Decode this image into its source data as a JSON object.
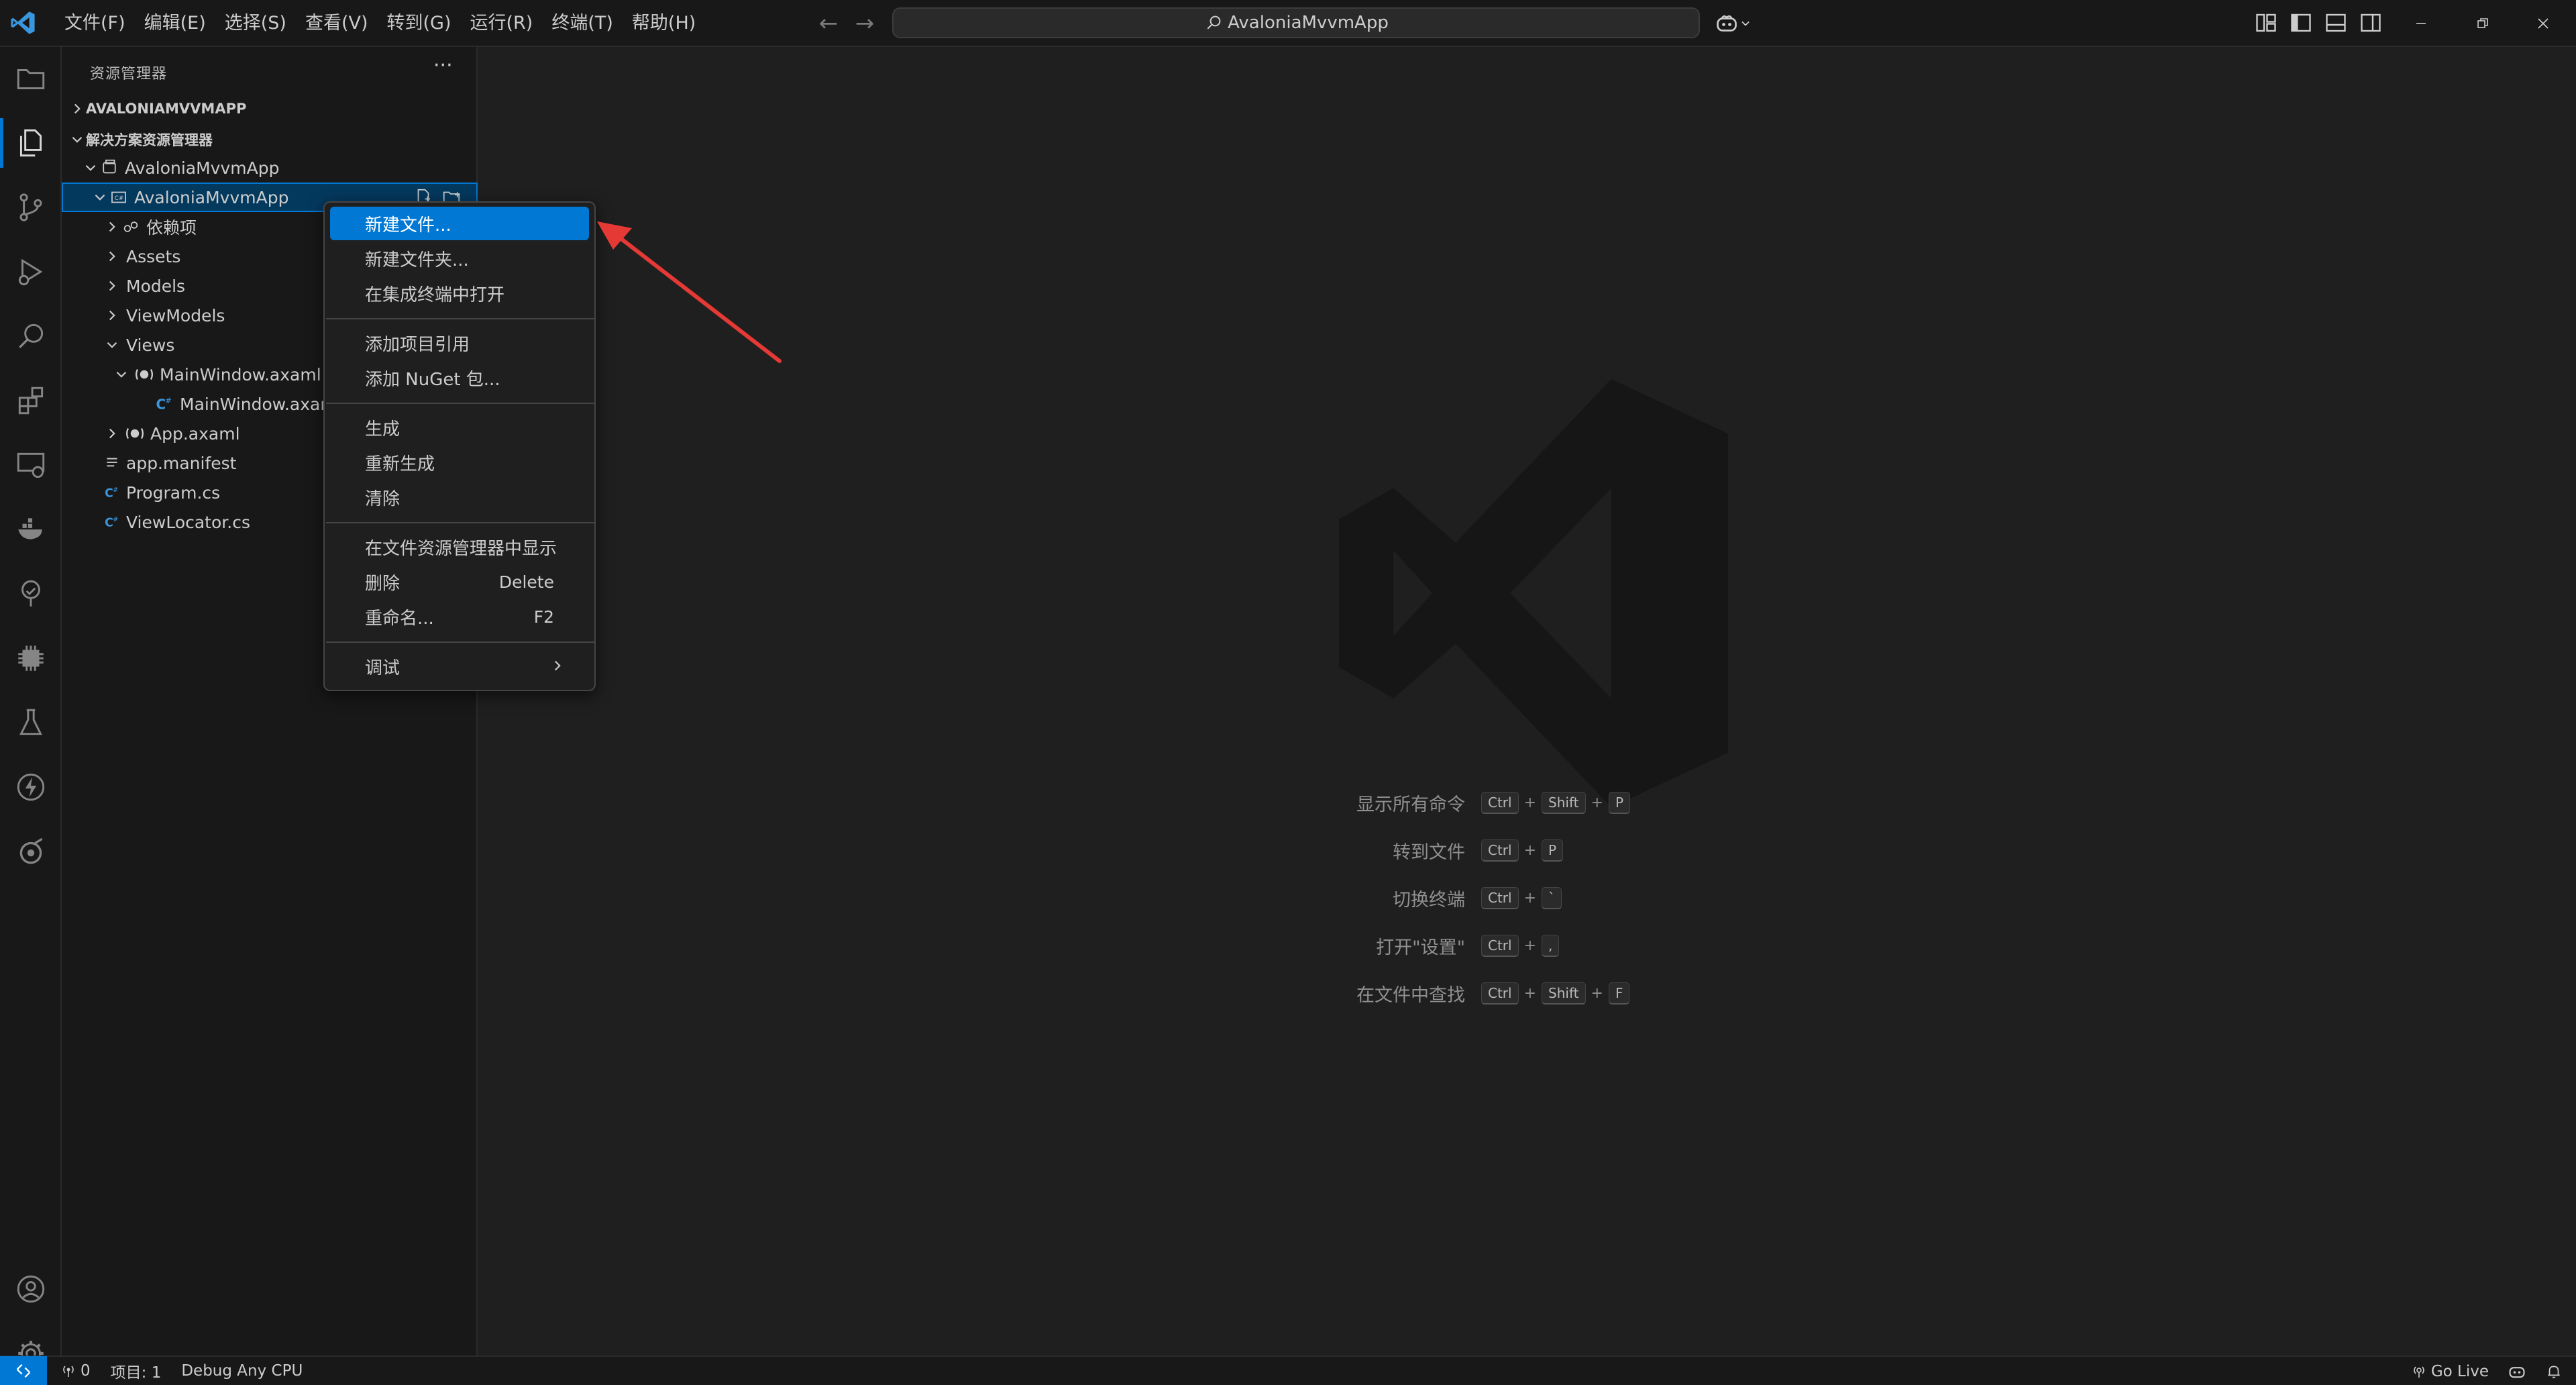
{
  "window": {
    "search_text": "AvaloniaMvvmApp",
    "back_glyph": "←",
    "forward_glyph": "→"
  },
  "menu": [
    "文件(F)",
    "编辑(E)",
    "选择(S)",
    "查看(V)",
    "转到(G)",
    "运行(R)",
    "终端(T)",
    "帮助(H)"
  ],
  "sidebar": {
    "header": "资源管理器",
    "more": "···",
    "sections": [
      "AVALONIAMVVMAPP",
      "解决方案资源管理器"
    ],
    "tree": [
      {
        "label": "AvaloniaMvvmApp",
        "icon": "solution-icon"
      },
      {
        "label": "AvaloniaMvvmApp",
        "icon": "project-icon"
      },
      {
        "label": "依赖项",
        "icon": "dependencies-icon"
      },
      {
        "label": "Assets",
        "icon": ""
      },
      {
        "label": "Models",
        "icon": ""
      },
      {
        "label": "ViewModels",
        "icon": ""
      },
      {
        "label": "Views",
        "icon": ""
      },
      {
        "label": "MainWindow.axaml",
        "icon": "axaml-icon"
      },
      {
        "label": "MainWindow.axam",
        "icon": "csharp-icon"
      },
      {
        "label": "App.axaml",
        "icon": "axaml-icon"
      },
      {
        "label": "app.manifest",
        "icon": "manifest-icon"
      },
      {
        "label": "Program.cs",
        "icon": "csharp-icon"
      },
      {
        "label": "ViewLocator.cs",
        "icon": "csharp-icon"
      }
    ]
  },
  "context_menu": {
    "items": [
      {
        "label": "新建文件...",
        "key": ""
      },
      {
        "label": "新建文件夹...",
        "key": ""
      },
      {
        "label": "在集成终端中打开",
        "key": ""
      },
      {
        "label": "添加项目引用",
        "key": ""
      },
      {
        "label": "添加 NuGet 包...",
        "key": ""
      },
      {
        "label": "生成",
        "key": ""
      },
      {
        "label": "重新生成",
        "key": ""
      },
      {
        "label": "清除",
        "key": ""
      },
      {
        "label": "在文件资源管理器中显示",
        "key": ""
      },
      {
        "label": "删除",
        "key": "Delete"
      },
      {
        "label": "重命名...",
        "key": "F2"
      },
      {
        "label": "调试",
        "key": ""
      }
    ]
  },
  "editor_hints": [
    {
      "label": "显示所有命令",
      "keys": [
        "Ctrl",
        "Shift",
        "P"
      ]
    },
    {
      "label": "转到文件",
      "keys": [
        "Ctrl",
        "P"
      ]
    },
    {
      "label": "切换终端",
      "keys": [
        "Ctrl",
        "`"
      ]
    },
    {
      "label": "打开\"设置\"",
      "keys": [
        "Ctrl",
        ","
      ]
    },
    {
      "label": "在文件中查找",
      "keys": [
        "Ctrl",
        "Shift",
        "F"
      ]
    }
  ],
  "statusbar": {
    "ports": "0",
    "project": "项目: 1",
    "config": "Debug Any CPU",
    "go_live": "Go Live"
  },
  "colors": {
    "accent": "#0078d4",
    "background": "#1f1f1f",
    "chrome": "#181818",
    "annotation": "#e53935"
  }
}
